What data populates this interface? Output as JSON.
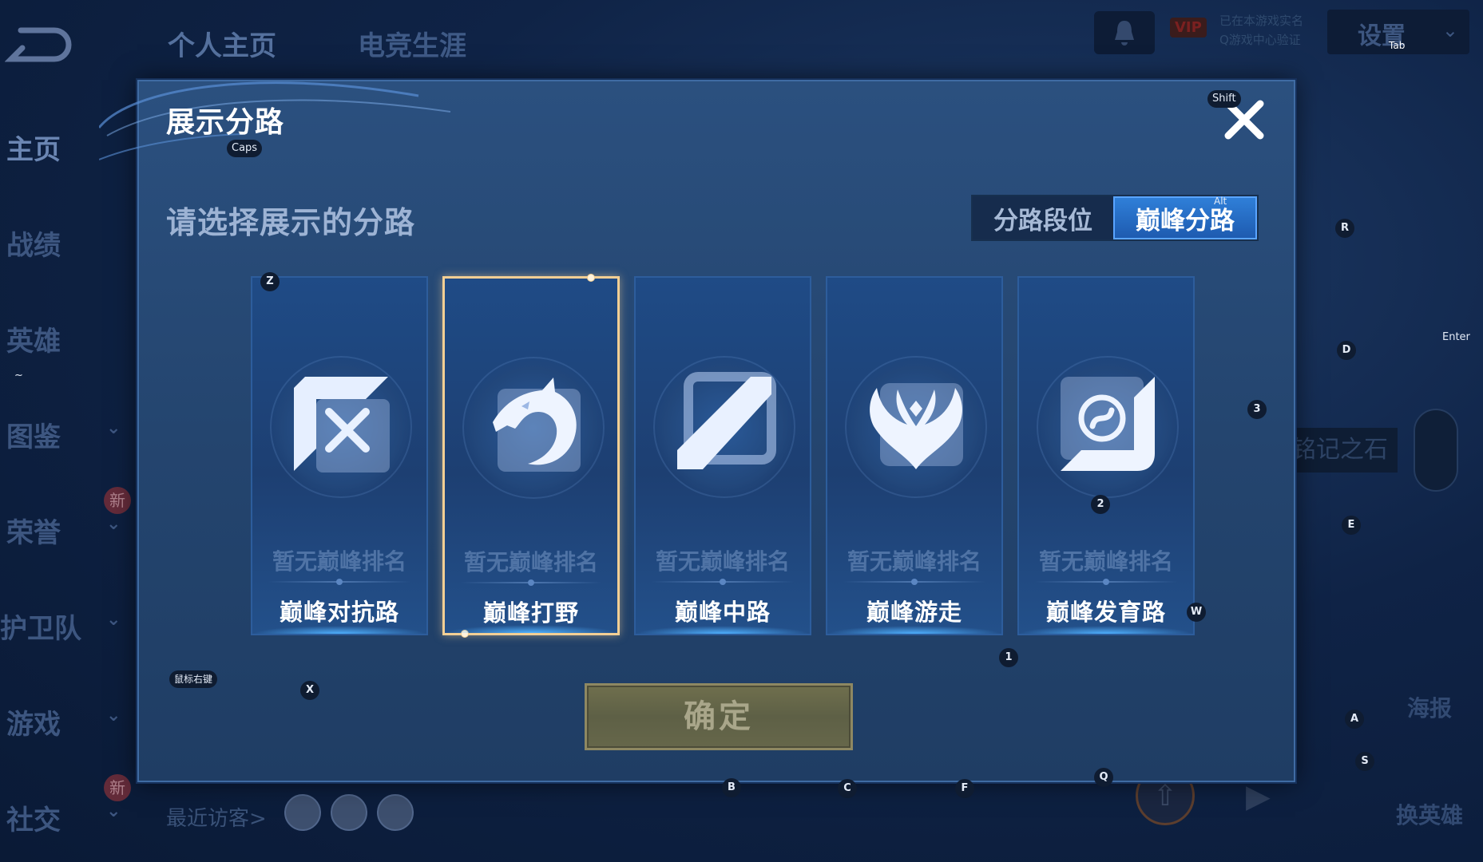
{
  "background": {
    "back_icon": "back-arrow-icon",
    "top_tabs": [
      {
        "label": "个人主页"
      },
      {
        "label": "电竞生涯"
      }
    ],
    "side_nav": [
      {
        "label": "主页",
        "has_chevron": false,
        "new_badge": ""
      },
      {
        "label": "战绩",
        "has_chevron": false,
        "new_badge": ""
      },
      {
        "label": "英雄",
        "has_chevron": false,
        "new_badge": ""
      },
      {
        "label": "图鉴",
        "has_chevron": true,
        "new_badge": ""
      },
      {
        "label": "荣誉",
        "has_chevron": true,
        "new_badge": "新"
      },
      {
        "label": "护卫队",
        "has_chevron": true,
        "new_badge": ""
      },
      {
        "label": "游戏",
        "has_chevron": true,
        "new_badge": ""
      },
      {
        "label": "社交",
        "has_chevron": true,
        "new_badge": "新"
      }
    ],
    "vip_label": "VIP",
    "vip_note_line1": "已在本游戏实名",
    "vip_note_line2": "Q游戏中心验证",
    "settings_label": "设置",
    "recent_visitors_label": "最近访客>",
    "stone_label": "铭记之石",
    "poster_label": "海报",
    "switch_hero_label": "换英雄"
  },
  "modal": {
    "title": "展示分路",
    "prompt": "请选择展示的分路",
    "segment": {
      "options": [
        {
          "label": "分路段位",
          "active": false
        },
        {
          "label": "巅峰分路",
          "active": true
        }
      ]
    },
    "lanes": [
      {
        "name": "巅峰对抗路",
        "rank_text": "暂无巅峰排名",
        "icon": "clash-lane-icon",
        "selected": false
      },
      {
        "name": "巅峰打野",
        "rank_text": "暂无巅峰排名",
        "icon": "jungle-dragon-icon",
        "selected": true
      },
      {
        "name": "巅峰中路",
        "rank_text": "暂无巅峰排名",
        "icon": "mid-lane-icon",
        "selected": false
      },
      {
        "name": "巅峰游走",
        "rank_text": "暂无巅峰排名",
        "icon": "roam-wings-icon",
        "selected": false
      },
      {
        "name": "巅峰发育路",
        "rank_text": "暂无巅峰排名",
        "icon": "farm-lane-icon",
        "selected": false
      }
    ],
    "confirm_label": "确定"
  },
  "key_hints": {
    "tab": "Tab",
    "shift": "Shift",
    "caps": "Caps",
    "alt": "Alt",
    "enter": "Enter",
    "tilde": "~",
    "mouse_right": "鼠标右键",
    "z": "Z",
    "x": "X",
    "c": "C",
    "b": "B",
    "f": "F",
    "q": "Q",
    "w": "W",
    "e": "E",
    "r": "R",
    "d": "D",
    "a": "A",
    "s": "S",
    "one": "1",
    "two": "2",
    "three": "3"
  },
  "colors": {
    "accent_blue": "#2f7fd8",
    "selected_border": "#f3cf94",
    "modal_bg": "#24456f",
    "confirm_bg": "#66674a"
  }
}
